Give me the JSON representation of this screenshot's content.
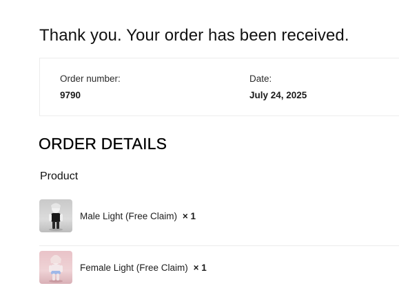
{
  "heading": "Thank you. Your order has been received.",
  "overview": {
    "order_number_label": "Order number:",
    "order_number": "9790",
    "date_label": "Date:",
    "date": "July 24, 2025"
  },
  "details": {
    "title": "ORDER DETAILS",
    "product_header": "Product",
    "items": [
      {
        "name": "Male Light (Free Claim)",
        "qty": "× 1",
        "thumbnail": "male-avatar-figure"
      },
      {
        "name": "Female Light (Free Claim)",
        "qty": "× 1",
        "thumbnail": "female-avatar-figure"
      }
    ]
  }
}
